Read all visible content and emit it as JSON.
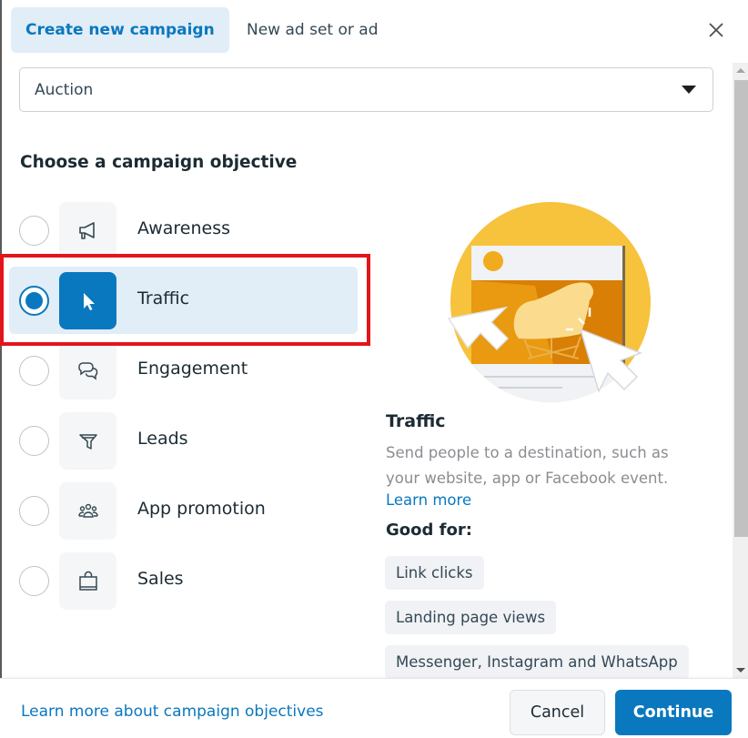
{
  "header": {
    "tabs": [
      {
        "label": "Create new campaign",
        "active": true
      },
      {
        "label": "New ad set or ad",
        "active": false
      }
    ],
    "close_icon": "close-icon"
  },
  "buying_type": {
    "selected": "Auction",
    "icon": "caret-down-icon"
  },
  "objectives": {
    "title": "Choose a campaign objective",
    "items": [
      {
        "label": "Awareness",
        "icon": "megaphone-icon",
        "selected": false
      },
      {
        "label": "Traffic",
        "icon": "cursor-icon",
        "selected": true
      },
      {
        "label": "Engagement",
        "icon": "chat-bubbles-icon",
        "selected": false
      },
      {
        "label": "Leads",
        "icon": "funnel-icon",
        "selected": false
      },
      {
        "label": "App promotion",
        "icon": "people-icon",
        "selected": false
      },
      {
        "label": "Sales",
        "icon": "shopping-bag-icon",
        "selected": false
      }
    ]
  },
  "detail": {
    "title": "Traffic",
    "description": "Send people to a destination, such as your website, app or Facebook event.",
    "learn_more": "Learn more",
    "good_for_label": "Good for:",
    "good_for": [
      "Link clicks",
      "Landing page views",
      "Messenger, Instagram and WhatsApp"
    ],
    "illustration": "traffic-illustration"
  },
  "scrollbar": {
    "position_fraction": 0.0,
    "visible_fraction": 0.78
  },
  "footer": {
    "learn_more_link": "Learn more about campaign objectives",
    "cancel_label": "Cancel",
    "continue_label": "Continue"
  },
  "colors": {
    "accent": "#0a78be",
    "selected_bg": "#e1edf7",
    "highlight": "#e2151a"
  }
}
